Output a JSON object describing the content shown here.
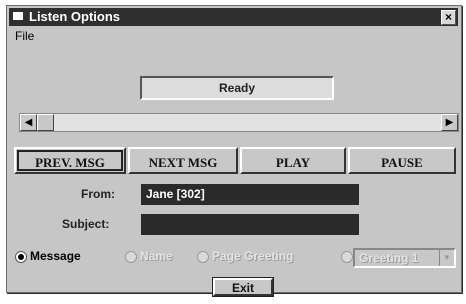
{
  "window": {
    "title": "Listen Options",
    "close_glyph": "×"
  },
  "menu": {
    "file": "File"
  },
  "status": {
    "text": "Ready"
  },
  "scrollbar": {
    "left_glyph": "◀",
    "right_glyph": "▶",
    "position": 0
  },
  "buttons": {
    "prev": "PREV. MSG",
    "next": "NEXT MSG",
    "play": "PLAY",
    "pause": "PAUSE"
  },
  "fields": {
    "from_label": "From:",
    "from_value": "Jane [302]",
    "subject_label": "Subject:",
    "subject_value": ""
  },
  "radios": {
    "message": "Message",
    "name": "Name",
    "page_greeting": "Page Greeting",
    "selected": "message"
  },
  "greeting_select": {
    "value": "Greeting 1",
    "arrow_glyph": "▼"
  },
  "exit_label": "Exit",
  "icons": {
    "window": "window-icon",
    "close": "close-icon"
  }
}
